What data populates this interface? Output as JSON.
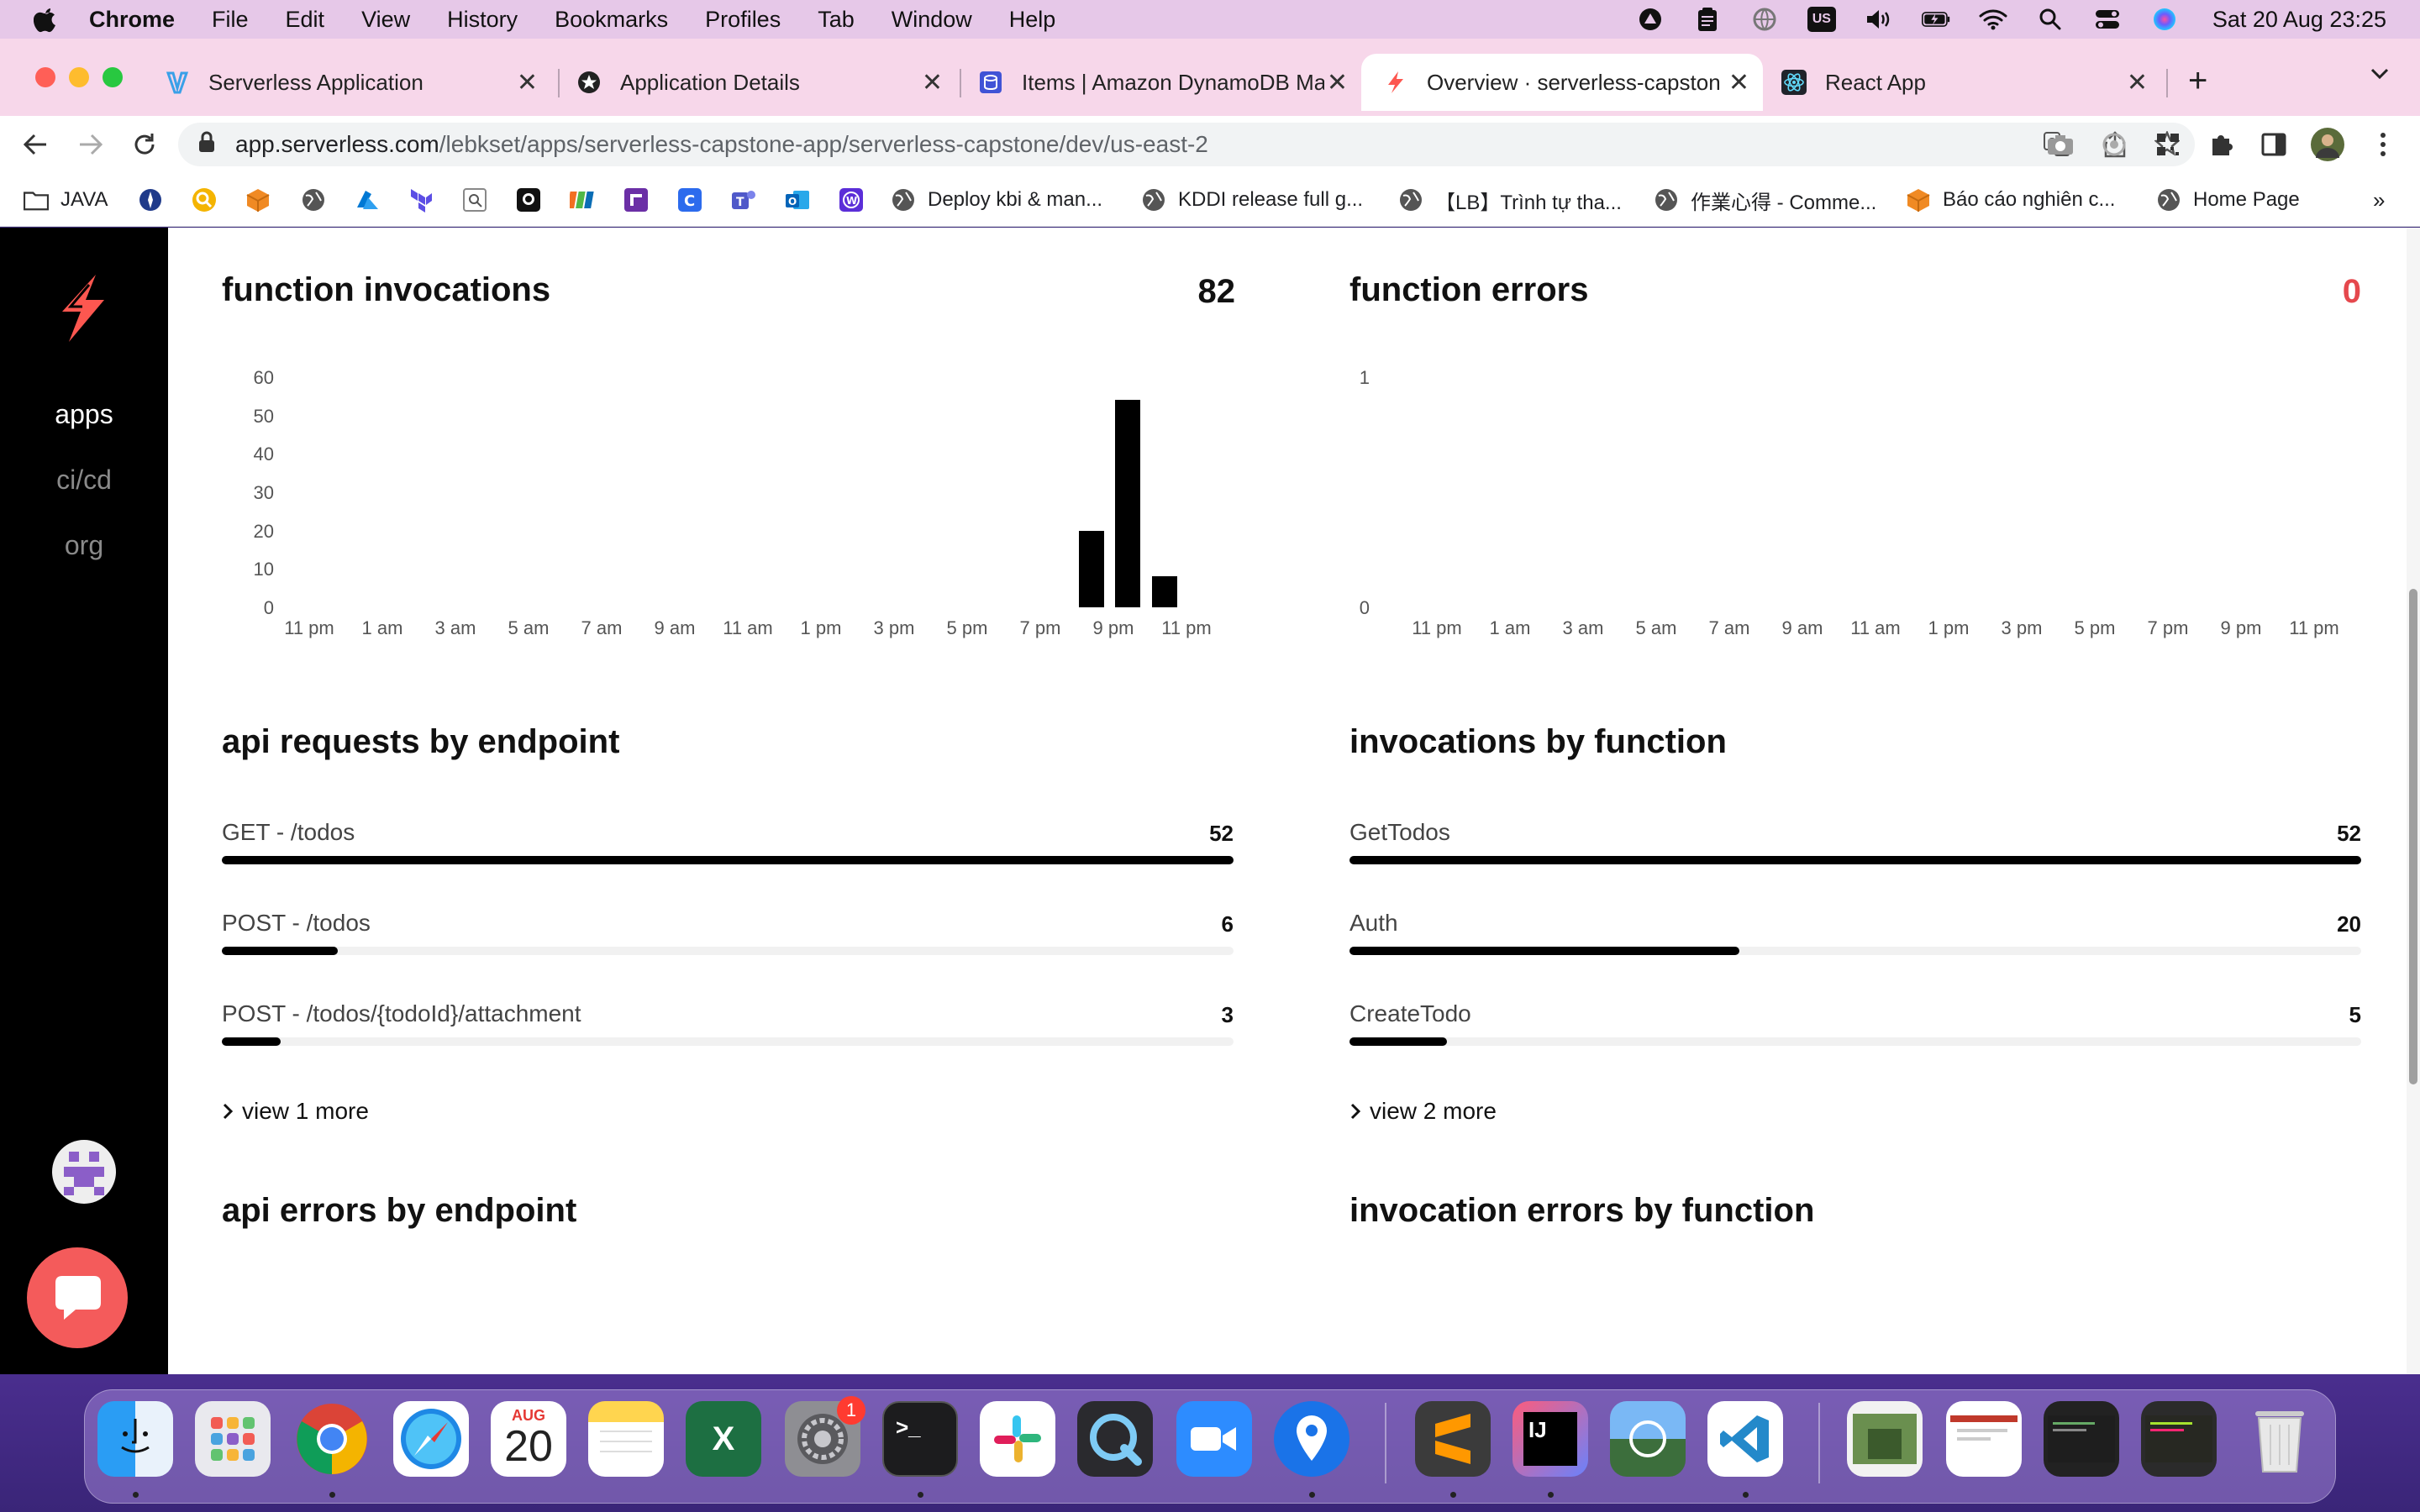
{
  "menubar": {
    "app_name": "Chrome",
    "items": [
      "File",
      "Edit",
      "View",
      "History",
      "Bookmarks",
      "Profiles",
      "Tab",
      "Window",
      "Help"
    ],
    "clock": "Sat 20 Aug  23:25",
    "input_source": "US"
  },
  "tabs": [
    {
      "title": "Serverless Application",
      "icon": "serverless-icon"
    },
    {
      "title": "Application Details",
      "icon": "gear-badge-icon"
    },
    {
      "title": "Items | Amazon DynamoDB Ma",
      "icon": "dynamodb-icon"
    },
    {
      "title": "Overview · serverless-capstone",
      "icon": "serverless-bolt-icon",
      "active": true
    },
    {
      "title": "React App",
      "icon": "react-icon"
    }
  ],
  "address": {
    "host": "app.serverless.com",
    "path": "/lebkset/apps/serverless-capstone-app/serverless-capstone/dev/us-east-2"
  },
  "bookmarks": [
    {
      "label": "JAVA",
      "icon": "folder-icon"
    },
    {
      "label": "Deploy kbi & man...",
      "icon": "globe-icon"
    },
    {
      "label": "KDDI release full g...",
      "icon": "globe-icon"
    },
    {
      "label": "【LB】Trình tự tha...",
      "icon": "globe-icon"
    },
    {
      "label": "作業心得 - Comme...",
      "icon": "globe-icon"
    },
    {
      "label": "Báo cáo nghiên c...",
      "icon": "cube-icon"
    },
    {
      "label": "Home Page",
      "icon": "globe-icon"
    }
  ],
  "sidebar": {
    "items": [
      {
        "label": "apps",
        "active": true
      },
      {
        "label": "ci/cd",
        "active": false
      },
      {
        "label": "org",
        "active": false
      }
    ]
  },
  "panels": {
    "invocations": {
      "title": "function invocations",
      "total": "82",
      "y_ticks": [
        "60",
        "50",
        "40",
        "30",
        "20",
        "10",
        "0"
      ],
      "x_ticks": [
        "11 pm",
        "1 am",
        "3 am",
        "5 am",
        "7 am",
        "9 am",
        "11 am",
        "1 pm",
        "3 pm",
        "5 pm",
        "7 pm",
        "9 pm",
        "11 pm"
      ]
    },
    "errors": {
      "title": "function errors",
      "total": "0",
      "y_ticks": [
        "1",
        "0"
      ],
      "x_ticks": [
        "11 pm",
        "1 am",
        "3 am",
        "5 am",
        "7 am",
        "9 am",
        "11 am",
        "1 pm",
        "3 pm",
        "5 pm",
        "7 pm",
        "9 pm",
        "11 pm"
      ]
    },
    "api_requests": {
      "title": "api requests by endpoint",
      "rows": [
        {
          "label": "GET - /todos",
          "value": "52",
          "fraction": 1.0
        },
        {
          "label": "POST - /todos",
          "value": "6",
          "fraction": 0.115
        },
        {
          "label": "POST - /todos/{todoId}/attachment",
          "value": "3",
          "fraction": 0.058
        }
      ],
      "more": "view 1 more"
    },
    "invocations_by_function": {
      "title": "invocations by function",
      "rows": [
        {
          "label": "GetTodos",
          "value": "52",
          "fraction": 1.0
        },
        {
          "label": "Auth",
          "value": "20",
          "fraction": 0.385
        },
        {
          "label": "CreateTodo",
          "value": "5",
          "fraction": 0.096
        }
      ],
      "more": "view 2 more"
    },
    "api_errors": {
      "title": "api errors by endpoint"
    },
    "invocation_errors": {
      "title": "invocation errors by function"
    }
  },
  "chart_data": [
    {
      "type": "bar",
      "title": "function invocations",
      "x": [
        "9 pm",
        "10 pm",
        "11 pm"
      ],
      "values": [
        20,
        54,
        8
      ],
      "ylim": [
        0,
        60
      ],
      "x_ticks": [
        "11 pm",
        "1 am",
        "3 am",
        "5 am",
        "7 am",
        "9 am",
        "11 am",
        "1 pm",
        "3 pm",
        "5 pm",
        "7 pm",
        "9 pm",
        "11 pm"
      ]
    },
    {
      "type": "bar",
      "title": "function errors",
      "x": [],
      "values": [],
      "ylim": [
        0,
        1
      ]
    }
  ],
  "colors": {
    "sidebar_bg": "#000000",
    "brand_red": "#fd5750",
    "error_total": "#e5484d",
    "bar": "#000000"
  },
  "dock": {
    "calendar_month": "AUG",
    "calendar_day": "20",
    "settings_badge": "1",
    "apps": [
      "finder-icon",
      "launchpad-icon",
      "chrome-icon",
      "safari-icon",
      "calendar-icon",
      "notes-icon",
      "excel-icon",
      "system-preferences-icon",
      "terminal-icon",
      "slack-icon",
      "quicktime-icon",
      "zoom-icon",
      "maps-pin-icon",
      "sublime-icon",
      "intellij-icon",
      "preview-icon",
      "vscode-icon",
      "trash-icon"
    ]
  }
}
